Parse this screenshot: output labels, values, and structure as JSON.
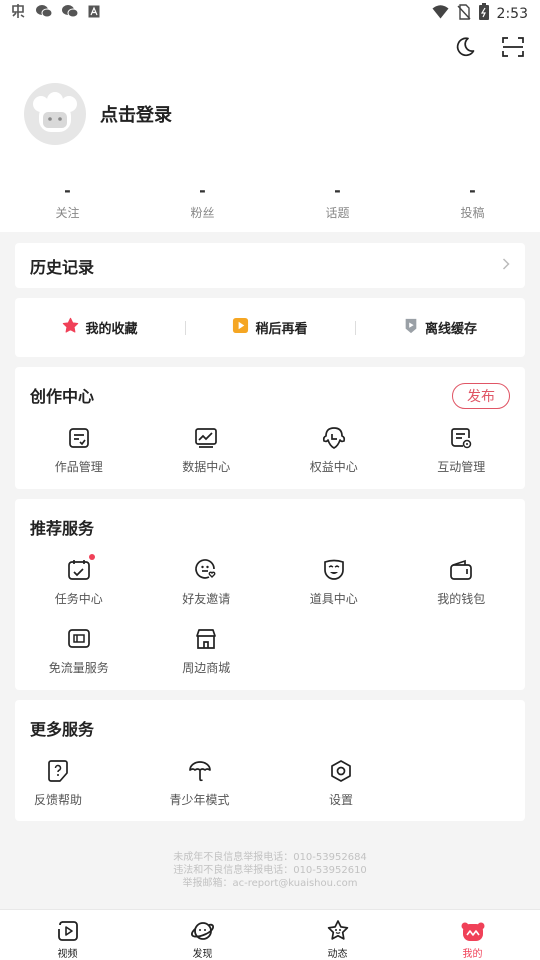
{
  "status_bar": {
    "time": "2:53",
    "left_icons": [
      "app-icon",
      "wechat-icon",
      "wechat-icon",
      "text-icon"
    ],
    "right_icons": [
      "wifi-icon",
      "no-sim-icon",
      "battery-icon"
    ]
  },
  "header": {
    "icons": [
      "moon-icon",
      "scan-icon"
    ]
  },
  "profile": {
    "login_text": "点击登录"
  },
  "stats": [
    {
      "value": "-",
      "label": "关注"
    },
    {
      "value": "-",
      "label": "粉丝"
    },
    {
      "value": "-",
      "label": "话题"
    },
    {
      "value": "-",
      "label": "投稿"
    }
  ],
  "history": {
    "title": "历史记录"
  },
  "quick_actions": [
    {
      "label": "我的收藏",
      "icon": "star-icon",
      "color": "#f04158"
    },
    {
      "label": "稍后再看",
      "icon": "play-later-icon",
      "color": "#f5a623"
    },
    {
      "label": "离线缓存",
      "icon": "download-icon",
      "color": "#9aa0a6"
    }
  ],
  "creation": {
    "title": "创作中心",
    "publish_label": "发布",
    "items": [
      {
        "label": "作品管理",
        "icon": "works-icon"
      },
      {
        "label": "数据中心",
        "icon": "data-chart-icon"
      },
      {
        "label": "权益中心",
        "icon": "rights-icon"
      },
      {
        "label": "互动管理",
        "icon": "interaction-icon"
      }
    ]
  },
  "recommend": {
    "title": "推荐服务",
    "items": [
      {
        "label": "任务中心",
        "icon": "calendar-task-icon",
        "dot": true
      },
      {
        "label": "好友邀请",
        "icon": "invite-friend-icon"
      },
      {
        "label": "道具中心",
        "icon": "mask-icon"
      },
      {
        "label": "我的钱包",
        "icon": "wallet-icon"
      },
      {
        "label": "免流量服务",
        "icon": "sim-card-icon"
      },
      {
        "label": "周边商城",
        "icon": "shop-icon"
      }
    ]
  },
  "more": {
    "title": "更多服务",
    "items": [
      {
        "label": "反馈帮助",
        "icon": "feedback-icon"
      },
      {
        "label": "青少年模式",
        "icon": "umbrella-icon"
      },
      {
        "label": "设置",
        "icon": "settings-icon"
      }
    ]
  },
  "footer": {
    "lines": [
      "未成年不良信息举报电话：010-53952684",
      "违法和不良信息举报电话：010-53952610",
      "举报邮箱：ac-report@kuaishou.com"
    ]
  },
  "nav": [
    {
      "label": "视频",
      "icon": "video-icon",
      "active": false
    },
    {
      "label": "发现",
      "icon": "planet-icon",
      "active": false
    },
    {
      "label": "动态",
      "icon": "star-face-icon",
      "active": false
    },
    {
      "label": "我的",
      "icon": "bear-icon",
      "active": true
    }
  ],
  "colors": {
    "accent": "#f04158",
    "publish": "#e05565",
    "background": "#f4f4f4"
  }
}
